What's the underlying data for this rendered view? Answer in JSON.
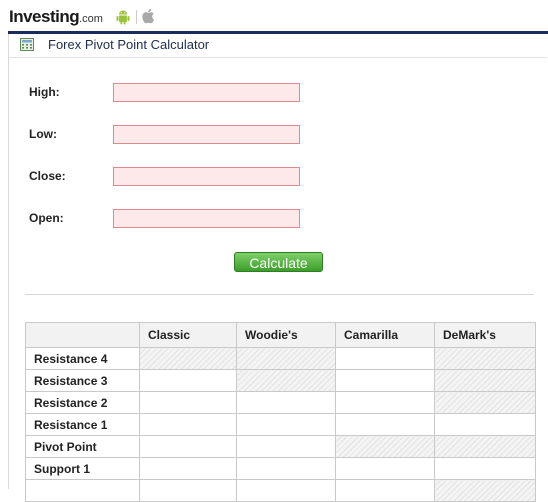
{
  "header": {
    "logo_main": "Investing",
    "logo_domain": ".com",
    "icons": [
      "android-icon",
      "apple-icon"
    ]
  },
  "calculator": {
    "title": "Forex Pivot Point Calculator",
    "fields": [
      {
        "label": "High:",
        "value": ""
      },
      {
        "label": "Low:",
        "value": ""
      },
      {
        "label": "Close:",
        "value": ""
      },
      {
        "label": "Open:",
        "value": ""
      }
    ],
    "calculate_label": "Calculate"
  },
  "table": {
    "columns": [
      "",
      "Classic",
      "Woodie's",
      "Camarilla",
      "DeMark's"
    ],
    "rows": [
      {
        "label": "Resistance 4",
        "disabled": [
          true,
          true,
          false,
          true
        ]
      },
      {
        "label": "Resistance 3",
        "disabled": [
          false,
          true,
          false,
          true
        ]
      },
      {
        "label": "Resistance 2",
        "disabled": [
          false,
          false,
          false,
          true
        ]
      },
      {
        "label": "Resistance 1",
        "disabled": [
          false,
          false,
          false,
          false
        ]
      },
      {
        "label": "Pivot Point",
        "disabled": [
          false,
          false,
          true,
          true
        ]
      },
      {
        "label": "Support 1",
        "disabled": [
          false,
          false,
          false,
          false
        ]
      },
      {
        "label": "",
        "disabled": [
          false,
          false,
          false,
          true
        ]
      }
    ]
  },
  "colors": {
    "brand_bar": "#1a2d5a",
    "input_border": "#e0898f",
    "input_bg": "#fde8ea",
    "button_green": "#4caf37"
  }
}
